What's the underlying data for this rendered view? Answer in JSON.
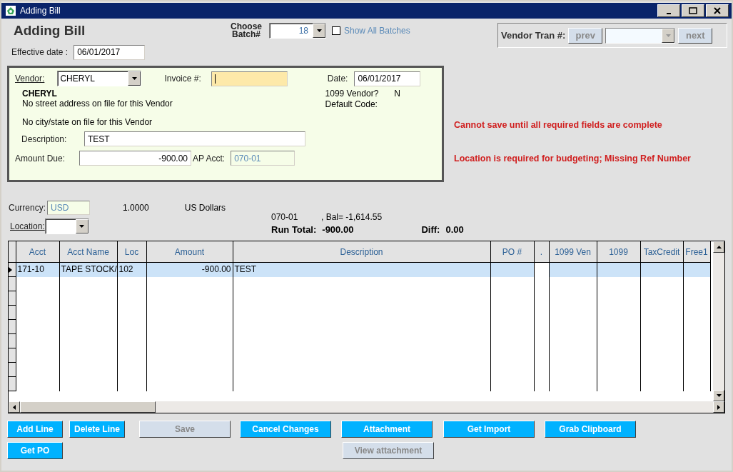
{
  "window": {
    "title": "Adding Bill"
  },
  "header": {
    "title": "Adding Bill",
    "batch_label": "Choose Batch#",
    "batch_value": "18",
    "show_all_batches": {
      "label": "Show All Batches",
      "checked": false
    },
    "effective_date_label": "Effective date :",
    "effective_date": "06/01/2017"
  },
  "vendor_tran": {
    "label": "Vendor Tran #:",
    "prev": "prev",
    "next": "next",
    "disabled": true
  },
  "vendor_panel": {
    "vendor_label": "Vendor:",
    "vendor": "CHERYL",
    "invoice_label": "Invoice #:",
    "date_label": "Date:",
    "date": "06/01/2017",
    "vendor_name": "CHERYL",
    "address_line": "No street address on file for this Vendor",
    "city_line": "No city/state on file for this Vendor",
    "vendor_1099_label": "1099 Vendor?",
    "vendor_1099": "N",
    "default_code_label": "Default Code:",
    "description_label": "Description:",
    "description": "TEST",
    "amount_due_label": "Amount Due:",
    "amount_due": "-900.00",
    "ap_acct_label": "AP Acct:",
    "ap_acct": "070-01"
  },
  "messages": [
    "Cannot save until all required fields are complete",
    "Location is required for budgeting; Missing Ref Number"
  ],
  "currency": {
    "label": "Currency:",
    "code": "USD",
    "rate": "1.0000",
    "name": "US Dollars",
    "location_label": "Location:"
  },
  "totals": {
    "account": "070-01",
    "balance": ", Bal= -1,614.55",
    "run_total_label": "Run Total:",
    "run_total": "-900.00",
    "diff_label": "Diff:",
    "diff": "0.00"
  },
  "grid": {
    "columns": [
      "Acct",
      "Acct Name",
      "Loc",
      "Amount",
      "Description",
      "PO #",
      ".",
      "1099 Ven",
      "1099",
      "TaxCredit",
      "Free1"
    ],
    "rows": [
      {
        "selected": true,
        "cells": [
          "171-10",
          "TAPE STOCK/",
          "102",
          "-900.00",
          "TEST",
          "",
          "",
          "",
          "",
          "",
          ""
        ]
      }
    ]
  },
  "buttons": [
    {
      "label": "Add Line",
      "disabled": false
    },
    {
      "label": "Delete Line",
      "disabled": false
    },
    {
      "label": "Save",
      "disabled": true
    },
    {
      "label": "Cancel Changes",
      "disabled": false
    },
    {
      "label": "Attachment",
      "disabled": false
    },
    {
      "label": "Get Import",
      "disabled": false
    },
    {
      "label": "Grab Clipboard",
      "disabled": false
    }
  ],
  "buttons_row_2": [
    {
      "label": "Get PO",
      "disabled": false
    },
    {
      "label": "View attachment",
      "disabled": true
    }
  ]
}
